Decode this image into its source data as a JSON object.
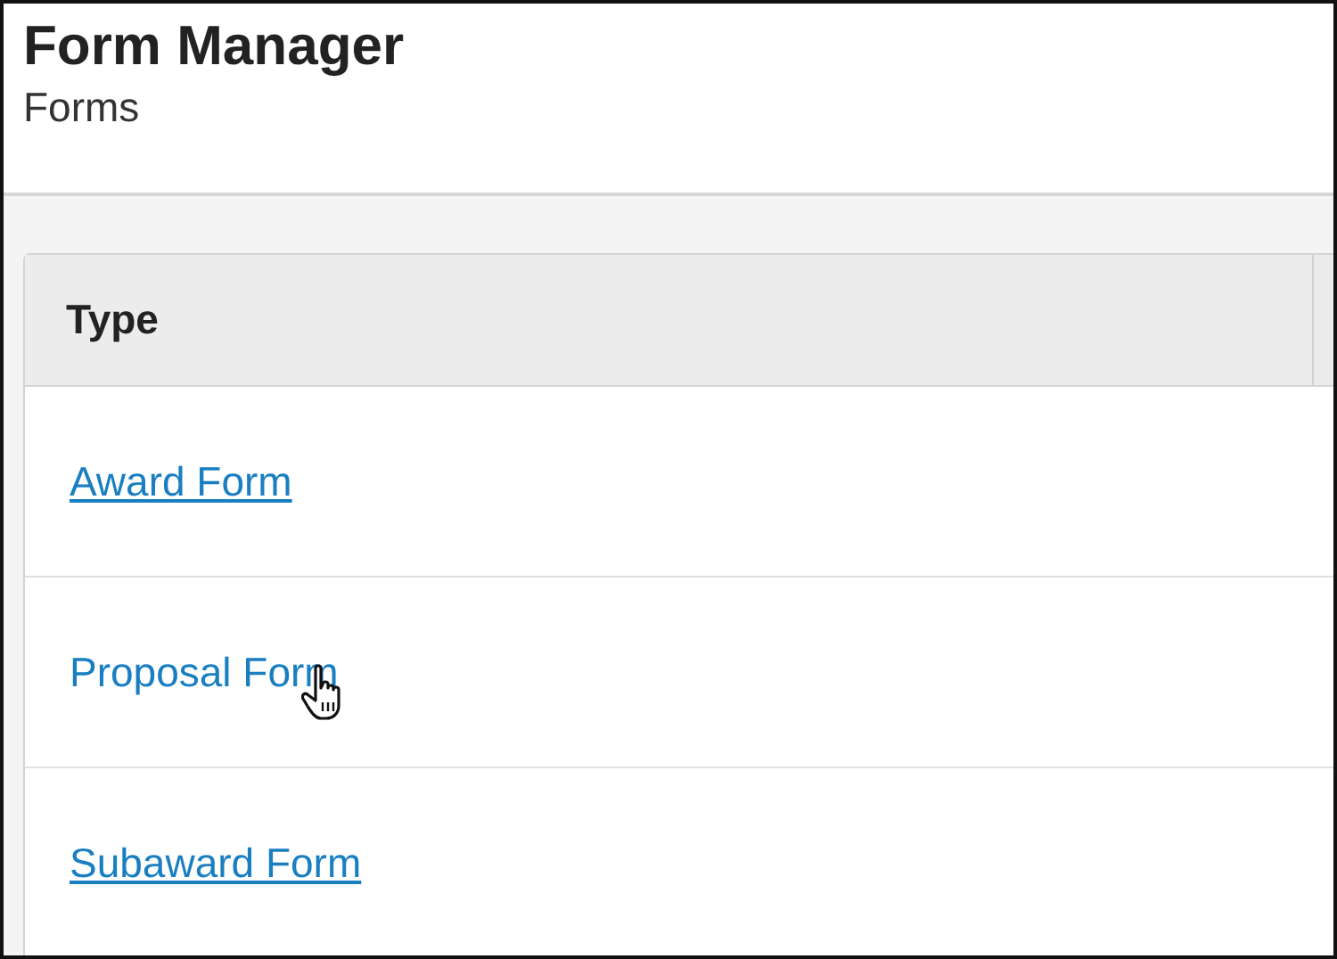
{
  "header": {
    "title": "Form Manager",
    "subtitle": "Forms"
  },
  "table": {
    "columns": [
      "Type"
    ],
    "rows": [
      {
        "label": "Award Form",
        "hovered": false
      },
      {
        "label": "Proposal Form",
        "hovered": true
      },
      {
        "label": "Subaward Form",
        "hovered": false
      }
    ]
  }
}
